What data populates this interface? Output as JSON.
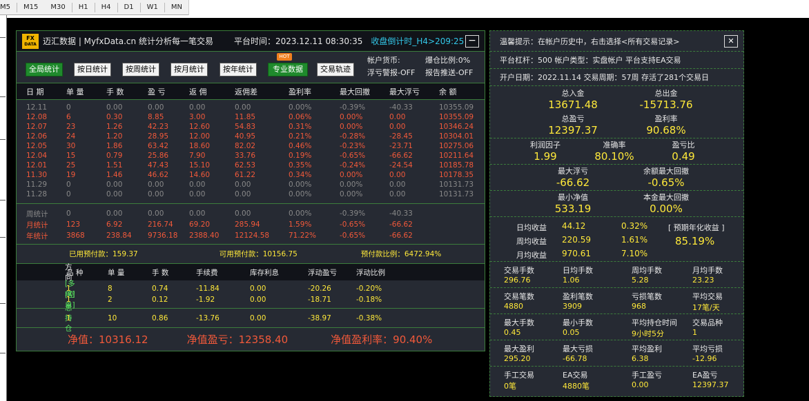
{
  "timeframes": [
    "M5",
    "M15",
    "M30",
    "H1",
    "H4",
    "D1",
    "W1",
    "MN"
  ],
  "header": {
    "logo_top": "FX",
    "logo_bottom": "DATA",
    "title": "迈汇数据 | MyfxData.cn  统计分析每一笔交易",
    "platform_time": "平台时间：2023.12.11 08:30:35",
    "countdown": "收盘倒计时_H4>209:25",
    "min_label": "−"
  },
  "buttons": [
    "全局统计",
    "按日统计",
    "按周统计",
    "按月统计",
    "按年统计",
    "专业数据",
    "交易轨迹"
  ],
  "hot_label": "HOT",
  "account_info": {
    "currency": "帐户货币:",
    "ratio": "爆仓比例:0%",
    "warn": "浮亏警报-OFF",
    "push": "报告推送-OFF"
  },
  "table": {
    "headers": [
      "日 期",
      "单 量",
      "手 数",
      "盈 亏",
      "返 佣",
      "返佣差",
      "盈利率",
      "最大回撤",
      "最大浮亏",
      "余 额"
    ],
    "rows": [
      [
        "12.11",
        "0",
        "0.00",
        "0.00",
        "0.00",
        "0.00",
        "0.00%",
        "-0.39%",
        "-40.33",
        "10355.09"
      ],
      [
        "12.08",
        "6",
        "0.30",
        "8.85",
        "3.00",
        "11.85",
        "0.06%",
        "0.00%",
        "0.00",
        "10355.09"
      ],
      [
        "12.07",
        "23",
        "1.26",
        "42.23",
        "12.60",
        "54.83",
        "0.31%",
        "0.00%",
        "0.00",
        "10346.24"
      ],
      [
        "12.06",
        "24",
        "1.20",
        "28.95",
        "12.00",
        "40.95",
        "0.21%",
        "-0.28%",
        "-28.45",
        "10304.01"
      ],
      [
        "12.05",
        "30",
        "1.86",
        "63.42",
        "18.60",
        "82.02",
        "0.46%",
        "-0.23%",
        "-23.71",
        "10275.06"
      ],
      [
        "12.04",
        "15",
        "0.79",
        "25.86",
        "7.90",
        "33.76",
        "0.19%",
        "-0.65%",
        "-66.62",
        "10211.64"
      ],
      [
        "12.01",
        "25",
        "1.51",
        "47.43",
        "15.10",
        "62.53",
        "0.35%",
        "-0.24%",
        "-24.54",
        "10185.78"
      ],
      [
        "11.30",
        "19",
        "1.46",
        "46.62",
        "14.60",
        "61.22",
        "0.34%",
        "0.00%",
        "0.00",
        "10178.35"
      ],
      [
        "11.29",
        "0",
        "0.00",
        "0.00",
        "0.00",
        "0.00",
        "0.00%",
        "0.00%",
        "0.00",
        "10131.73"
      ],
      [
        "11.28",
        "0",
        "0.00",
        "0.00",
        "0.00",
        "0.00",
        "0.00%",
        "0.00%",
        "0.00",
        "10131.73"
      ]
    ],
    "row_colors": [
      "gray",
      "red",
      "red",
      "red",
      "red",
      "red",
      "red",
      "red",
      "gray",
      "gray"
    ],
    "summary": [
      [
        "周统计",
        "0",
        "0.00",
        "0.00",
        "0.00",
        "0.00",
        "0.00%",
        "-0.39%",
        "-40.33",
        ""
      ],
      [
        "月统计",
        "123",
        "6.92",
        "216.74",
        "69.20",
        "285.94",
        "1.59%",
        "-0.65%",
        "-66.62",
        ""
      ],
      [
        "年统计",
        "3868",
        "238.84",
        "9736.18",
        "2388.40",
        "12124.58",
        "71.22%",
        "-0.65%",
        "-66.62",
        ""
      ]
    ],
    "summary_colors": [
      "gray",
      "red",
      "red"
    ]
  },
  "margin": {
    "used": "已用预付款：159.37",
    "free": "可用预付款：10156.75",
    "ratio": "预付款比例：6472.94%"
  },
  "positions": {
    "headers": [
      "方 向",
      "品 种",
      "单 量",
      "手 数",
      "手续费",
      "库存利息",
      "浮动盈亏",
      "浮动比例"
    ],
    "rows": [
      [
        "[多单]",
        "1",
        "8",
        "0.74",
        "-11.84",
        "0.00",
        "-20.26",
        "-0.20%"
      ],
      [
        "[空单]",
        "1",
        "2",
        "0.12",
        "-1.92",
        "0.00",
        "-18.71",
        "-0.18%"
      ]
    ],
    "total": [
      "总持仓",
      "1",
      "10",
      "0.86",
      "-13.76",
      "0.00",
      "-38.97",
      "-0.38%"
    ]
  },
  "equity": {
    "net": "净值：10316.12",
    "pnl": "净值盈亏：12358.40",
    "rate": "净值盈利率：90.40%"
  },
  "right": {
    "tip": "温馨提示：在帐户历史中，右击选择<所有交易记录>",
    "close_label": "✕",
    "line1": "平台杠杆：500    帐户类型：实盘帐户    平台支持EA交易",
    "line2": "开户日期：2022.11.14   交易周期：57周   存活了281个交易日",
    "deposit_k": "总入金",
    "deposit_v": "13671.48",
    "withdraw_k": "总出金",
    "withdraw_v": "-15713.76",
    "pnl_k": "总盈亏",
    "pnl_v": "12397.37",
    "rate_k": "盈利率",
    "rate_v": "90.68%",
    "pf_k": "利润因子",
    "pf_v": "1.99",
    "acc_k": "准确率",
    "acc_v": "80.10%",
    "plr_k": "盈亏比",
    "plr_v": "0.49",
    "mfl_k": "最大浮亏",
    "mfl_v": "-66.62",
    "bdd_k": "余额最大回撤",
    "bdd_v": "-0.65%",
    "mne_k": "最小净值",
    "mne_v": "533.19",
    "pdd_k": "本金最大回撤",
    "pdd_v": "0.00%",
    "daily_k": "日均收益",
    "daily_v": "44.12",
    "daily_p": "0.32%",
    "weekly_k": "周均收益",
    "weekly_v": "220.59",
    "weekly_p": "1.61%",
    "monthly_k": "月均收益",
    "monthly_v": "970.61",
    "monthly_p": "7.10%",
    "annual_k": "[ 预期年化收益 ]",
    "annual_v": "85.19%",
    "g1": [
      [
        "交易手数",
        "296.76"
      ],
      [
        "日均手数",
        "1.06"
      ],
      [
        "周均手数",
        "5.28"
      ],
      [
        "月均手数",
        "23.23"
      ]
    ],
    "g2": [
      [
        "交易笔数",
        "4880"
      ],
      [
        "盈利笔数",
        "3909"
      ],
      [
        "亏损笔数",
        "968"
      ],
      [
        "平均交易",
        "17笔/天"
      ]
    ],
    "g3": [
      [
        "最大手数",
        "0.45"
      ],
      [
        "最小手数",
        "0.05"
      ],
      [
        "平均持仓时间",
        "9小时5分"
      ],
      [
        "交易品种",
        "1"
      ]
    ],
    "g4": [
      [
        "最大盈利",
        "295.20"
      ],
      [
        "最大亏损",
        "-66.78"
      ],
      [
        "平均盈利",
        "6.38"
      ],
      [
        "平均亏损",
        "-12.96"
      ]
    ],
    "g5": [
      [
        "手工交易",
        "0笔"
      ],
      [
        "EA交易",
        "4880笔"
      ],
      [
        "手工盈亏",
        "0.00"
      ],
      [
        "EA盈亏",
        "12397.37"
      ]
    ]
  }
}
